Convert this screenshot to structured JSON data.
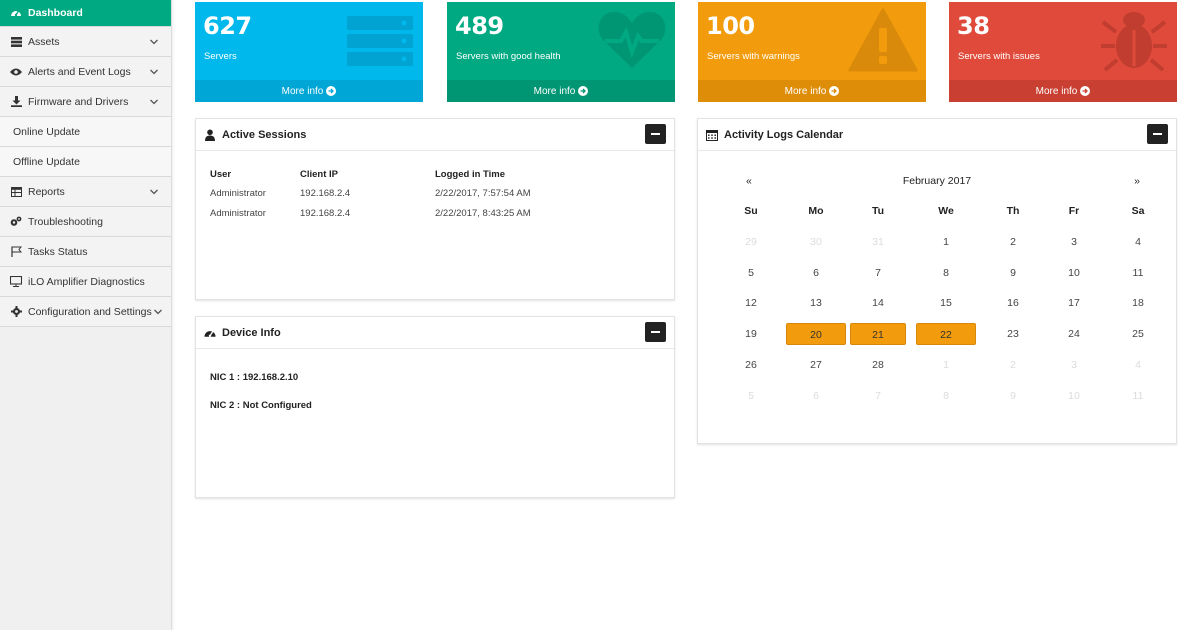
{
  "sidebar": {
    "items": [
      {
        "label": "Dashboard",
        "icon": "gauge-icon",
        "active": true
      },
      {
        "label": "Assets",
        "icon": "server-list-icon",
        "chevron": true
      },
      {
        "label": "Alerts and Event Logs",
        "icon": "eye-icon",
        "chevron": true
      },
      {
        "label": "Firmware and Drivers",
        "icon": "download-icon",
        "chevron": true
      },
      {
        "label": "Online Update",
        "sub": true
      },
      {
        "label": "Offline Update",
        "sub": true
      },
      {
        "label": "Reports",
        "icon": "table-icon",
        "chevron": true
      },
      {
        "label": "Troubleshooting",
        "icon": "cogs-icon"
      },
      {
        "label": "Tasks Status",
        "icon": "flag-icon"
      },
      {
        "label": "iLO Amplifier Diagnostics",
        "icon": "monitor-icon"
      },
      {
        "label": "Configuration and Settings",
        "icon": "gear-icon",
        "chevron": true
      }
    ]
  },
  "cards": [
    {
      "value": "627",
      "label": "Servers",
      "more": "More info",
      "icon": "server-stack-icon",
      "color": "#00b8eb"
    },
    {
      "value": "489",
      "label": "Servers with good health",
      "more": "More info",
      "icon": "heartbeat-icon",
      "color": "#01a982"
    },
    {
      "value": "100",
      "label": "Servers with warnings",
      "more": "More info",
      "icon": "warning-icon",
      "color": "#f29b0c"
    },
    {
      "value": "38",
      "label": "Servers with issues",
      "more": "More info",
      "icon": "bug-icon",
      "color": "#e04a3a"
    }
  ],
  "sessions": {
    "title": "Active Sessions",
    "columns": [
      "User",
      "Client IP",
      "Logged in Time"
    ],
    "rows": [
      [
        "Administrator",
        "192.168.2.4",
        "2/22/2017, 7:57:54 AM"
      ],
      [
        "Administrator",
        "192.168.2.4",
        "2/22/2017, 8:43:25 AM"
      ]
    ]
  },
  "device": {
    "title": "Device Info",
    "nic1": "NIC 1 : 192.168.2.10",
    "nic2": "NIC 2 : Not Configured"
  },
  "calendar": {
    "title": "Activity Logs Calendar",
    "prev": "«",
    "next": "»",
    "month": "February 2017",
    "weekdays": [
      "Su",
      "Mo",
      "Tu",
      "We",
      "Th",
      "Fr",
      "Sa"
    ],
    "weeks": [
      [
        "29",
        "30",
        "31",
        "1",
        "2",
        "3",
        "4"
      ],
      [
        "5",
        "6",
        "7",
        "8",
        "9",
        "10",
        "11"
      ],
      [
        "12",
        "13",
        "14",
        "15",
        "16",
        "17",
        "18"
      ],
      [
        "19",
        "20",
        "21",
        "22",
        "23",
        "24",
        "25"
      ],
      [
        "26",
        "27",
        "28",
        "1",
        "2",
        "3",
        "4"
      ],
      [
        "5",
        "6",
        "7",
        "8",
        "9",
        "10",
        "11"
      ]
    ],
    "muted": [
      [
        0,
        0
      ],
      [
        0,
        1
      ],
      [
        0,
        2
      ],
      [
        4,
        3
      ],
      [
        4,
        4
      ],
      [
        4,
        5
      ],
      [
        4,
        6
      ],
      [
        5,
        0
      ],
      [
        5,
        1
      ],
      [
        5,
        2
      ],
      [
        5,
        3
      ],
      [
        5,
        4
      ],
      [
        5,
        5
      ],
      [
        5,
        6
      ]
    ],
    "highlighted": [
      "20",
      "21",
      "22"
    ],
    "highlight_color": "#f29b0c"
  }
}
